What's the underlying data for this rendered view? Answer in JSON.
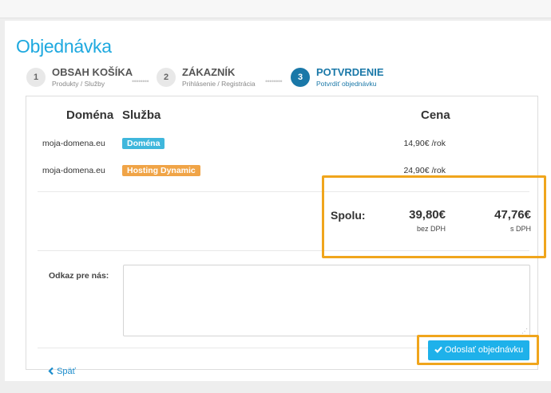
{
  "page_title": "Objednávka",
  "steps": [
    {
      "num": "1",
      "name": "OBSAH KOŠÍKA",
      "sub": "Produkty / Služby"
    },
    {
      "num": "2",
      "name": "ZÁKAZNÍK",
      "sub": "Prihlásenie / Registrácia"
    },
    {
      "num": "3",
      "name": "POTVRDENIE",
      "sub": "Potvrdiť objednávku"
    }
  ],
  "step_separator": "••••••••",
  "table": {
    "headers": {
      "domain": "Doména",
      "service": "Služba",
      "price": "Cena"
    },
    "rows": [
      {
        "domain": "moja-domena.eu",
        "service": "Doména",
        "price": "14,90€ /rok",
        "badge_color": "#3fb7dc"
      },
      {
        "domain": "moja-domena.eu",
        "service": "Hosting Dynamic",
        "price": "24,90€ /rok",
        "badge_color": "#f0a447"
      }
    ]
  },
  "totals": {
    "label": "Spolu:",
    "net": "39,80€",
    "net_label": "bez DPH",
    "gross": "47,76€",
    "gross_label": "s DPH"
  },
  "comment": {
    "label": "Odkaz pre nás:",
    "value": "",
    "grip": "⋰"
  },
  "back": {
    "icon": "chevron-left-icon",
    "label": "Späť"
  },
  "submit": {
    "icon": "check-icon",
    "label": "Odoslať objednávku"
  },
  "colors": {
    "accent": "#1ea9df",
    "highlight": "#f0a51c",
    "active_step": "#1a78a8",
    "submit_bg": "#1eb1ea"
  }
}
